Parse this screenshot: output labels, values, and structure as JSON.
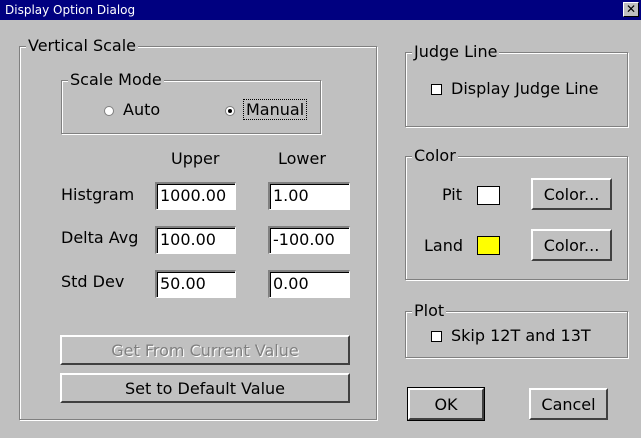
{
  "window": {
    "title": "Display Option Dialog",
    "close_glyph": "✕"
  },
  "vertical_scale": {
    "title": "Vertical Scale",
    "scale_mode": {
      "title": "Scale Mode",
      "options": [
        {
          "label": "Auto",
          "checked": false
        },
        {
          "label": "Manual",
          "checked": true
        }
      ]
    },
    "columns": [
      "Upper",
      "Lower"
    ],
    "rows": [
      {
        "label": "Histgram",
        "upper": "1000.00",
        "lower": "1.00"
      },
      {
        "label": "Delta Avg",
        "upper": "100.00",
        "lower": "-100.00"
      },
      {
        "label": "Std Dev",
        "upper": "50.00",
        "lower": "0.00"
      }
    ],
    "get_current_label": "Get From Current Value",
    "set_default_label": "Set to Default Value"
  },
  "judge_line": {
    "title": "Judge Line",
    "checkbox_label": "Display Judge Line",
    "checked": false
  },
  "color": {
    "title": "Color",
    "items": [
      {
        "label": "Pit",
        "swatch": "#ffffff",
        "button_label": "Color..."
      },
      {
        "label": "Land",
        "swatch": "#ffff00",
        "button_label": "Color..."
      }
    ]
  },
  "plot": {
    "title": "Plot",
    "checkbox_label": "Skip 12T and 13T",
    "checked": false
  },
  "footer": {
    "ok_label": "OK",
    "cancel_label": "Cancel"
  }
}
